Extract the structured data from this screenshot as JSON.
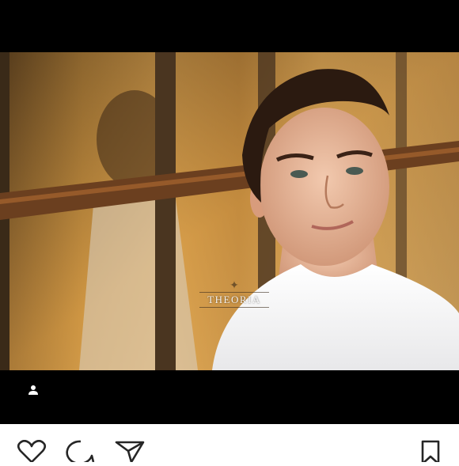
{
  "post": {
    "watermark_text": "THEORIA"
  },
  "icons": {
    "tag_user": "person-icon",
    "like": "heart-icon",
    "comment": "speech-bubble-icon",
    "share": "paper-plane-icon",
    "save": "bookmark-icon"
  },
  "colors": {
    "frame_background": "#000000",
    "action_bar_background": "#ffffff",
    "icon_stroke": "#262626"
  }
}
